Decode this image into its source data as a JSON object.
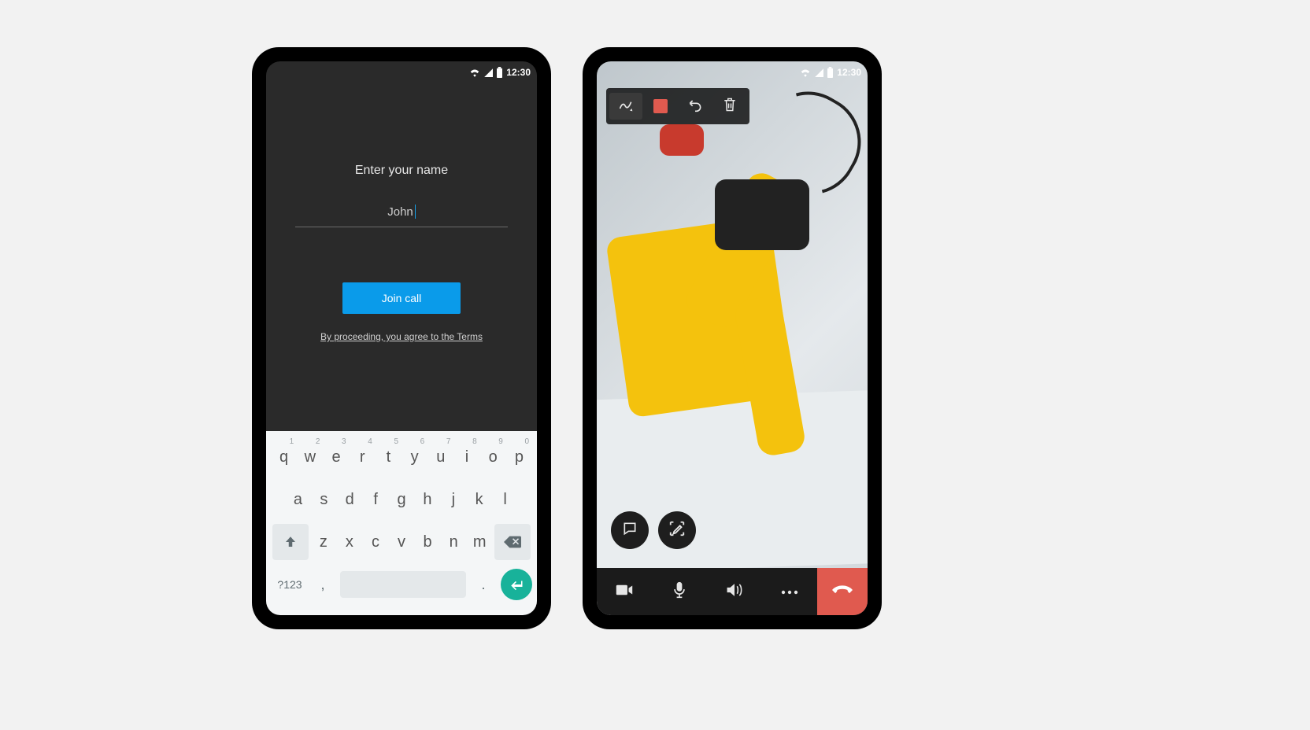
{
  "status_bar": {
    "time": "12:30"
  },
  "left": {
    "title": "Enter your name",
    "name_value": "John",
    "join_label": "Join call",
    "terms_label": "By proceeding, you agree to the Terms"
  },
  "keyboard": {
    "row1": [
      {
        "k": "q",
        "h": "1"
      },
      {
        "k": "w",
        "h": "2"
      },
      {
        "k": "e",
        "h": "3"
      },
      {
        "k": "r",
        "h": "4"
      },
      {
        "k": "t",
        "h": "5"
      },
      {
        "k": "y",
        "h": "6"
      },
      {
        "k": "u",
        "h": "7"
      },
      {
        "k": "i",
        "h": "8"
      },
      {
        "k": "o",
        "h": "9"
      },
      {
        "k": "p",
        "h": "0"
      }
    ],
    "row2": [
      "a",
      "s",
      "d",
      "f",
      "g",
      "h",
      "j",
      "k",
      "l"
    ],
    "row3": [
      "z",
      "x",
      "c",
      "v",
      "b",
      "n",
      "m"
    ],
    "symbols_label": "?123",
    "comma": ",",
    "dot": "."
  },
  "right": {
    "annotation_tools": {
      "pen": "pen-icon",
      "color": "#e05a4f",
      "undo": "undo-icon",
      "trash": "trash-icon"
    },
    "float": {
      "chat": "chat-icon",
      "draw": "draw-mode-icon"
    },
    "call_controls": {
      "video": "video-icon",
      "mic": "mic-icon",
      "speaker": "speaker-icon",
      "more": "more-icon",
      "end": "end-call-icon"
    }
  }
}
